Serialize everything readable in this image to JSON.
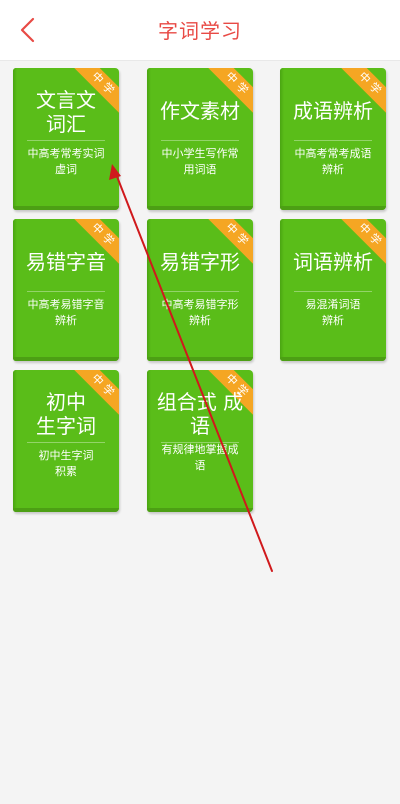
{
  "header": {
    "title": "字词学习",
    "back_icon": "chevron-left-icon",
    "accent_color": "#e84a45"
  },
  "books": [
    {
      "title": "文言文词汇",
      "title_lines": [
        "文言文",
        "词汇"
      ],
      "badge": "中学",
      "desc_lines": [
        "中高考常考实词",
        "虚词"
      ]
    },
    {
      "title": "作文素材",
      "title_lines": [
        "作文素材"
      ],
      "badge": "中学",
      "desc_lines": [
        "中小学生写作常",
        "用词语"
      ]
    },
    {
      "title": "成语辨析",
      "title_lines": [
        "成语辨析"
      ],
      "badge": "中学",
      "desc_lines": [
        "中高考常考成语",
        "辨析"
      ]
    },
    {
      "title": "易错字音",
      "title_lines": [
        "易错字音"
      ],
      "badge": "中学",
      "desc_lines": [
        "中高考易错字音",
        "辨析"
      ]
    },
    {
      "title": "易错字形",
      "title_lines": [
        "易错字形"
      ],
      "badge": "中学",
      "desc_lines": [
        "中高考易错字形",
        "辨析"
      ]
    },
    {
      "title": "词语辨析",
      "title_lines": [
        "词语辨析"
      ],
      "badge": "中学",
      "desc_lines": [
        "易混淆词语",
        "辨析"
      ]
    },
    {
      "title": "初中生字词",
      "title_lines": [
        "初中",
        "生字词"
      ],
      "badge": "中学",
      "desc_lines": [
        "初中生字词",
        "积累"
      ]
    },
    {
      "title": "组合式 成语",
      "title_lines": [
        "组合式 成",
        "语"
      ],
      "badge": "中学",
      "desc_lines": [
        "有规律地掌握成",
        "语"
      ]
    }
  ],
  "colors": {
    "book_green": "#5abd19",
    "badge_orange": "#f5a623",
    "pointer_red": "#d0191c"
  }
}
